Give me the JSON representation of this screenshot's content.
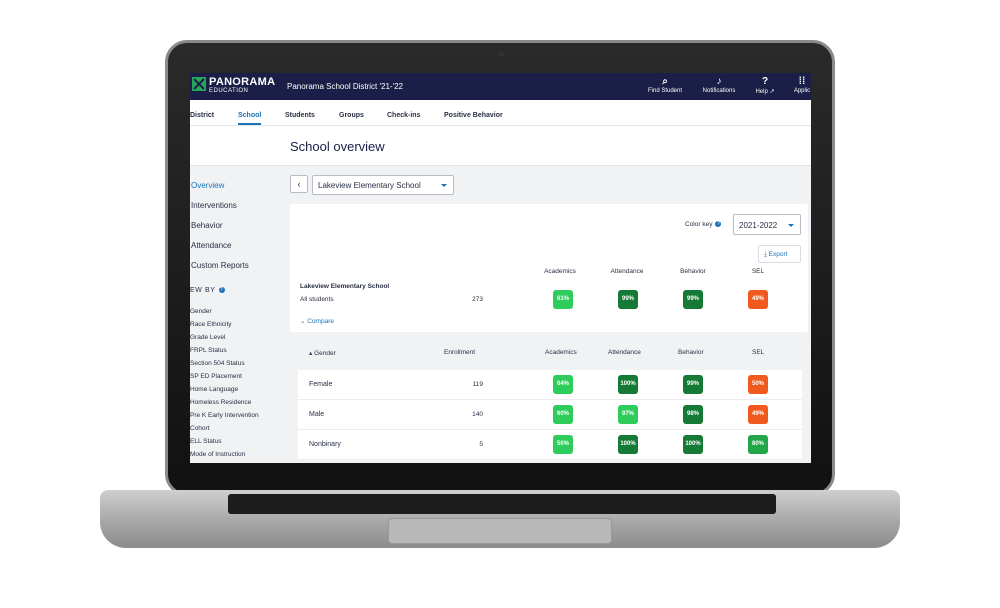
{
  "header": {
    "logo_text": "PANORAMA",
    "logo_sub": "EDUCATION",
    "district": "Panorama School District '21-'22",
    "nav": [
      {
        "glyph": "⌕",
        "label": "Find Student"
      },
      {
        "glyph": "♪",
        "label": "Notifications"
      },
      {
        "glyph": "?",
        "label": "Help ↗"
      },
      {
        "glyph": "⁞⁞",
        "label": "Applic"
      }
    ]
  },
  "tabs": [
    "District",
    "School",
    "Students",
    "Groups",
    "Check-ins",
    "Positive Behavior"
  ],
  "active_tab": "School",
  "page_title": "School overview",
  "sidebar": {
    "items": [
      "Overview",
      "Interventions",
      "Behavior",
      "Attendance",
      "Custom Reports"
    ],
    "viewby_label": "EW BY",
    "filters": [
      "Gender",
      "Race Ethnicity",
      "Grade Level",
      "FRPL Status",
      "Section 504 Status",
      "SP ED Placement",
      "Home Language",
      "Homeless Residence",
      "Pre K Early Intervention",
      "Cohort",
      "ELL Status",
      "Mode of Instruction"
    ]
  },
  "school_select": "Lakeview Elementary School",
  "back_glyph": "‹",
  "summary": {
    "color_key": "Color key",
    "year": "2021-2022",
    "export": "⤓ Export",
    "columns": [
      "Academics",
      "Attendance",
      "Behavior",
      "SEL"
    ],
    "school_name": "Lakeview Elementary School",
    "all_students": "All students",
    "enrollment": "273",
    "scores": [
      "61%",
      "99%",
      "99%",
      "49%"
    ],
    "compare": "⌄ Compare"
  },
  "table": {
    "group_header": "▴ Gender",
    "enrollment_header": "Enrollment",
    "columns": [
      "Academics",
      "Attendance",
      "Behavior",
      "SEL"
    ],
    "rows": [
      {
        "label": "Female",
        "enrollment": "119",
        "scores": [
          "64%",
          "100%",
          "99%",
          "50%"
        ]
      },
      {
        "label": "Male",
        "enrollment": "140",
        "scores": [
          "60%",
          "97%",
          "98%",
          "49%"
        ]
      },
      {
        "label": "Nonbinary",
        "enrollment": "5",
        "scores": [
          "50%",
          "100%",
          "100%",
          "80%"
        ]
      }
    ]
  },
  "colors": {
    "navy": "#1b1e47",
    "accent_blue": "#1a73b7",
    "light_green": "#2ecc5a",
    "mid_green": "#22a64a",
    "dark_green": "#157a35",
    "orange": "#f05a1e"
  }
}
